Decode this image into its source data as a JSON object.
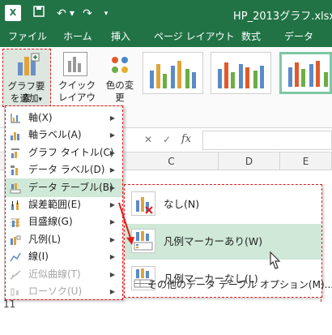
{
  "titlebar": {
    "app_icon": "excel-icon",
    "quick_access": [
      "save-icon",
      "undo-icon",
      "redo-icon",
      "customize-icon"
    ],
    "filename": "HP_2013グラフ.xlsx",
    "bg_color": "#217346"
  },
  "tabs": [
    "ファイル",
    "ホーム",
    "挿入",
    "ページ レイアウト",
    "数式",
    "データ"
  ],
  "ribbon": {
    "add_chart_element": {
      "line1": "グラフ要素",
      "line2": "を追加",
      "arrow": "▾"
    },
    "quick_layout": {
      "line1": "クイック",
      "line2": "レイアウト"
    },
    "change_colors": {
      "line1": "色の変",
      "line2": "更"
    }
  },
  "formula_bar": {
    "fx": "fx",
    "cancel": "✕",
    "confirm": "✓"
  },
  "columns": [
    "C",
    "D",
    "E"
  ],
  "rows": [
    "11"
  ],
  "menu": {
    "items": [
      {
        "label": "軸(X)",
        "icon": "axis-icon",
        "arrow": "▶",
        "state": "normal"
      },
      {
        "label": "軸ラベル(A)",
        "icon": "axis-label-icon",
        "arrow": "▶",
        "state": "normal"
      },
      {
        "label": "グラフ タイトル(C)",
        "icon": "chart-title-icon",
        "arrow": "▶",
        "state": "normal"
      },
      {
        "label": "データ ラベル(D)",
        "icon": "data-label-icon",
        "arrow": "▶",
        "state": "normal"
      },
      {
        "label": "データ テーブル(B)",
        "icon": "data-table-icon",
        "arrow": "▶",
        "state": "highlight"
      },
      {
        "label": "誤差範囲(E)",
        "icon": "error-bars-icon",
        "arrow": "▶",
        "state": "normal"
      },
      {
        "label": "目盛線(G)",
        "icon": "gridlines-icon",
        "arrow": "▶",
        "state": "normal"
      },
      {
        "label": "凡例(L)",
        "icon": "legend-icon",
        "arrow": "▶",
        "state": "normal"
      },
      {
        "label": "線(I)",
        "icon": "lines-icon",
        "arrow": "▶",
        "state": "normal"
      },
      {
        "label": "近似曲線(T)",
        "icon": "trendline-icon",
        "arrow": "▶",
        "state": "disabled"
      },
      {
        "label": "ローソク(U)",
        "icon": "updown-bars-icon",
        "arrow": "▶",
        "state": "disabled"
      }
    ]
  },
  "submenu": {
    "items": [
      {
        "label": "なし(N)",
        "icon": "data-table-none-icon",
        "state": "normal"
      },
      {
        "label": "凡例マーカーあり(W)",
        "icon": "data-table-with-legend-icon",
        "state": "highlight"
      },
      {
        "label": "凡例マーカーなし(L)",
        "icon": "data-table-no-legend-icon",
        "state": "normal"
      }
    ],
    "more_options": "その他のデータ テーブル オプション(M)..."
  },
  "colors": {
    "accent": "#217346",
    "highlight": "#cfe8d7",
    "annotation": "#e01b1b"
  }
}
